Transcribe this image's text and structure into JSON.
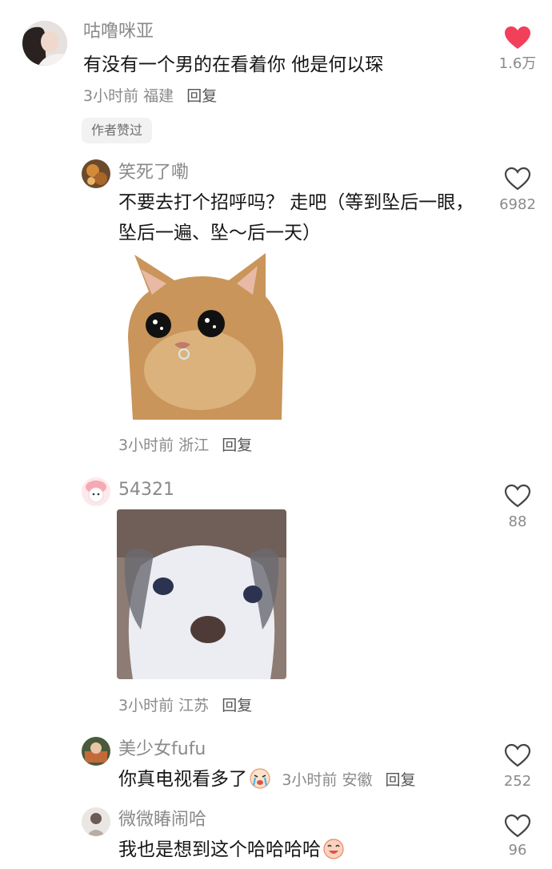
{
  "comments": [
    {
      "user": "咕噜咪亚",
      "text": "有没有一个男的在看着你 他是何以琛",
      "time": "3小时前",
      "location": "福建",
      "reply_label": "回复",
      "badge": "作者赞过",
      "likes": "1.6万",
      "liked": true
    },
    {
      "user": "笑死了嘞",
      "text": "不要去打个招呼吗？ 走吧（等到坠后一眼，坠后一遍、坠～后一天）",
      "time": "3小时前",
      "location": "浙江",
      "reply_label": "回复",
      "likes": "6982",
      "sticker": "crying-cat-sticker"
    },
    {
      "user": "54321",
      "time": "3小时前",
      "location": "江苏",
      "reply_label": "回复",
      "likes": "88",
      "sticker": "blurry-puppy-sticker"
    },
    {
      "user": "美少女fufu",
      "text": "你真电视看多了",
      "emoji": "crying-emoji",
      "time": "3小时前",
      "location": "安徽",
      "reply_label": "回复",
      "likes": "252"
    },
    {
      "user": "微微睶闹哈",
      "text": "我也是想到这个哈哈哈哈",
      "emoji": "laughing-emoji",
      "likes": "96"
    }
  ],
  "colors": {
    "liked_heart": "#f23f5a",
    "name": "#8a8a8a",
    "text": "#161616"
  }
}
